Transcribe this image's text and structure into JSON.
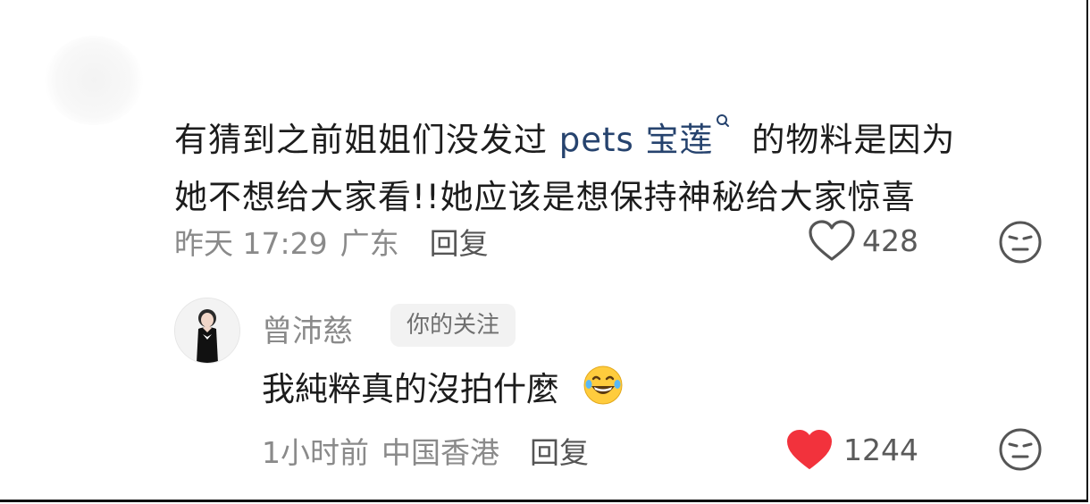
{
  "comment": {
    "text_before": "有猜到之前姐姐们没发过",
    "mention": "pets 宝莲",
    "mention_icon": "search-icon",
    "text_after_line1": "的物料是因为",
    "line2": "她不想给大家看!!她应该是想保持神秘给大家惊喜",
    "time": "昨天 17:29",
    "location": "广东",
    "reply_label": "回复",
    "like_count": "428",
    "liked": false
  },
  "reply": {
    "author": "曾沛慈",
    "badge": "你的关注",
    "text": "我純粹真的沒拍什麼",
    "emoji": "😂",
    "time": "1小时前",
    "location": "中国香港",
    "reply_label": "回复",
    "like_count": "1244",
    "liked": true
  },
  "colors": {
    "mention": "#26436e",
    "like_active": "#f2323c",
    "meta_text": "#8a8a8a"
  }
}
